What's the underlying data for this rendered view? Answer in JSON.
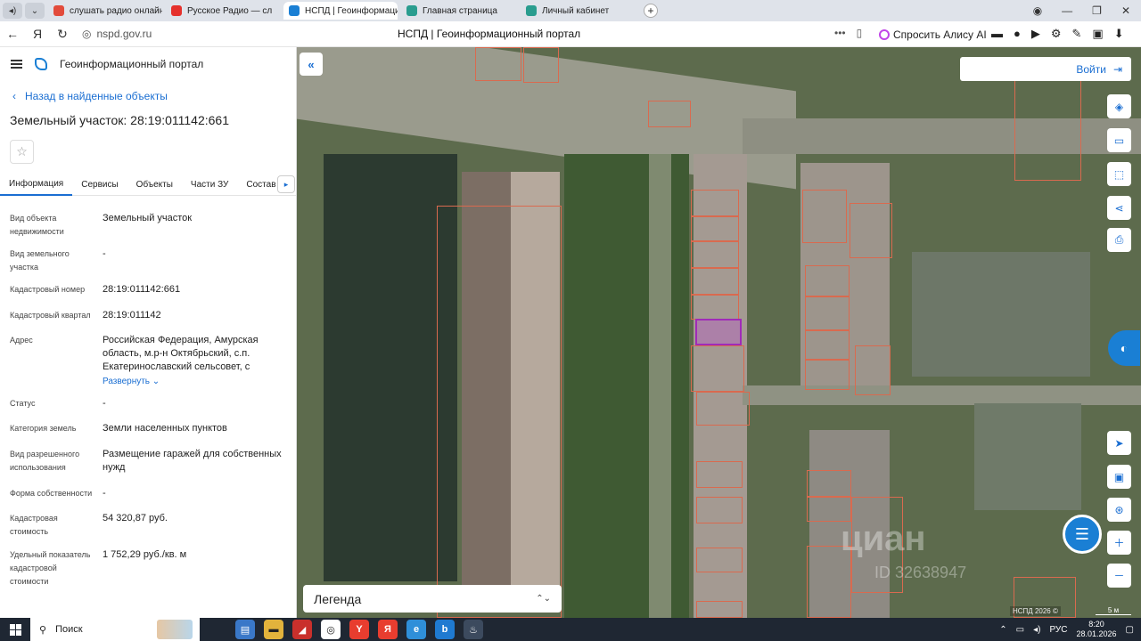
{
  "browser": {
    "tabs": [
      {
        "label": "слушать радио онлайн бе",
        "color": "#e24b3b"
      },
      {
        "label": "Русское Радио — сл",
        "color": "#e5312c"
      },
      {
        "label": "НСПД | Геоинформацио",
        "color": "#1a7fd4",
        "active": true
      },
      {
        "label": "Главная страница",
        "color": "#2a9d8f"
      },
      {
        "label": "Личный кабинет",
        "color": "#2a9d8f"
      }
    ],
    "url": "nspd.gov.ru",
    "page_title": "НСПД | Геоинформационный портал",
    "alice_label": "Спросить Алису AI"
  },
  "panel": {
    "app_title": "Геоинформационный портал",
    "back_label": "Назад в найденные объекты",
    "parcel_title": "Земельный участок: 28:19:011142:661",
    "tabs": [
      "Информация",
      "Сервисы",
      "Объекты",
      "Части ЗУ",
      "Состав"
    ],
    "fields": [
      {
        "label": "Вид объекта недвижимости",
        "value": "Земельный участок"
      },
      {
        "label": "Вид земельного участка",
        "value": "-"
      },
      {
        "label": "Кадастровый номер",
        "value": "28:19:011142:661"
      },
      {
        "label": "Кадастровый квартал",
        "value": "28:19:011142"
      },
      {
        "label": "Адрес",
        "value": "Российская Федерация, Амурская область, м.р-н Октябрьский, с.п. Екатеринославский сельсовет, с",
        "expand": "Развернуть"
      },
      {
        "label": "Статус",
        "value": "-"
      },
      {
        "label": "Категория земель",
        "value": "Земли населенных пунктов"
      },
      {
        "label": "Вид разрешенного использования",
        "value": "Размещение гаражей для собственных нужд"
      },
      {
        "label": "Форма собственности",
        "value": "-"
      },
      {
        "label": "Кадастровая стоимость",
        "value": "54 320,87 руб."
      },
      {
        "label": "Удельный показатель кадастровой стоимости",
        "value": "1 752,29 руб./кв. м"
      }
    ]
  },
  "map": {
    "login_label": "Войти",
    "legend_label": "Легенда",
    "copyright": "НСПД 2026 ©",
    "scale": "5 м",
    "watermark": "циан",
    "watermark_id": "ID 32638947"
  },
  "taskbar": {
    "search_label": "Поиск",
    "lang": "РУС",
    "time": "8:20",
    "date": "28.01.2026"
  }
}
